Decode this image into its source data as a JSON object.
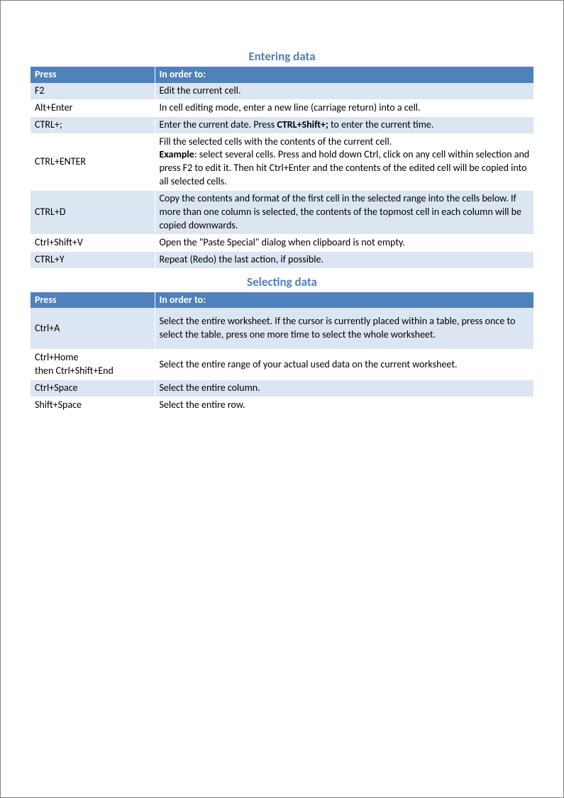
{
  "section1": {
    "title": "Entering data",
    "headers": {
      "press": "Press",
      "desc": "In order to:"
    },
    "rows": [
      {
        "press": "F2",
        "desc": "Edit the current cell."
      },
      {
        "press": "Alt+Enter",
        "desc": "In cell editing mode, enter a new line (carriage return) into a cell."
      },
      {
        "press": "CTRL+;",
        "desc_pre": "Enter the current date. Press ",
        "desc_bold": "CTRL+Shift+;",
        "desc_post": " to enter the current time."
      },
      {
        "press": "CTRL+ENTER",
        "line1": "Fill the selected cells with the contents of the current cell.",
        "line2_bold": "Example",
        "line2_rest": ": select several cells. Press and hold down Ctrl, click on any cell within selection and press F2 to edit it. Then hit Ctrl+Enter and the contents of the edited cell will be copied into all selected cells."
      },
      {
        "press": "CTRL+D",
        "desc": "Copy the contents and format of the first cell in the selected range into the cells below. If more than one column is selected, the contents of the topmost cell in each column will be copied downwards."
      },
      {
        "press": "Ctrl+Shift+V",
        "desc": "Open the \"Paste Special\" dialog when clipboard is not empty."
      },
      {
        "press": "CTRL+Y",
        "desc": "Repeat (Redo) the last action, if possible."
      }
    ]
  },
  "section2": {
    "title": "Selecting data",
    "headers": {
      "press": "Press",
      "desc": "In order to:"
    },
    "rows": [
      {
        "press": "Ctrl+A",
        "desc": "Select the entire worksheet.  If the cursor is currently placed within a table, press once to select the table, press one more time to select the whole worksheet."
      },
      {
        "press_line1": "Ctrl+Home",
        "press_line2": "then Ctrl+Shift+End",
        "desc": "Select the entire range of your actual used data on the current worksheet."
      },
      {
        "press": "Ctrl+Space",
        "desc": "Select the entire column."
      },
      {
        "press": "Shift+Space",
        "desc": "Select the entire row."
      }
    ]
  }
}
